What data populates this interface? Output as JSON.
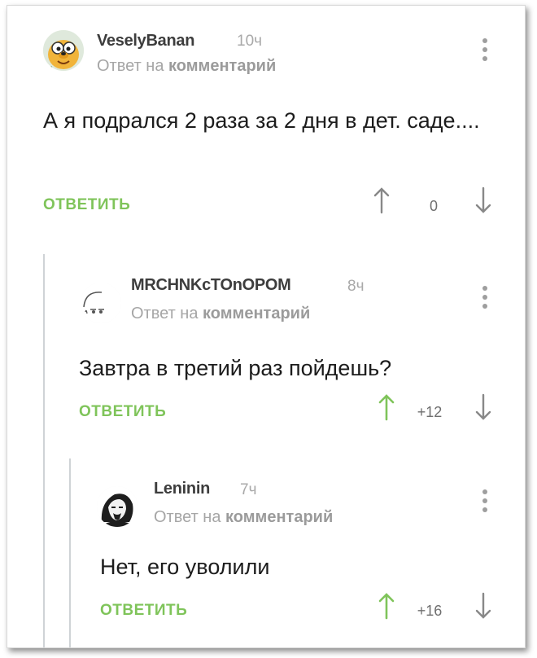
{
  "comments": [
    {
      "username": "VeselyBanan",
      "time": "10ч",
      "reply_prefix": "Ответ на",
      "reply_target": "комментарий",
      "text": "А я подрался 2 раза за 2 дня в дет. саде....",
      "reply_label": "ОТВЕТИТЬ",
      "score": "0",
      "up_active": false,
      "up_color": "#888888"
    },
    {
      "username": "MRCHNKcTOnOPOM",
      "time": "8ч",
      "reply_prefix": "Ответ на",
      "reply_target": "комментарий",
      "text": "Завтра в третий раз пойдешь?",
      "reply_label": "ОТВЕТИТЬ",
      "score": "+12",
      "up_active": true,
      "up_color": "#7fc45a"
    },
    {
      "username": "Leninin",
      "time": "7ч",
      "reply_prefix": "Ответ на",
      "reply_target": "комментарий",
      "text": "Нет, его уволили",
      "reply_label": "ОТВЕТИТЬ",
      "score": "+16",
      "up_active": true,
      "up_color": "#7fc45a"
    }
  ],
  "colors": {
    "accent_green": "#7fc45a",
    "thread_line": "#cfd3d6",
    "muted_text": "#a6a6a6"
  },
  "icons": {
    "more": "vertical-dots-icon",
    "up": "arrow-up-icon",
    "down": "arrow-down-icon"
  }
}
